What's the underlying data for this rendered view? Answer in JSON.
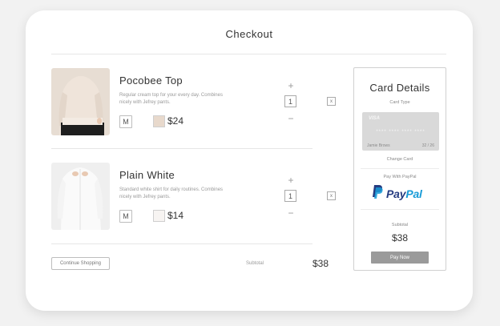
{
  "header": {
    "title": "Checkout"
  },
  "items": [
    {
      "name": "Pocobee Top",
      "description": "Regular cream top for your every day. Combines nicely with Jefrey pants.",
      "size": "M",
      "swatch_color": "#e8d9cc",
      "price": "$24",
      "qty_plus": "+",
      "quantity": "1",
      "qty_minus": "−",
      "remove": "x"
    },
    {
      "name": "Plain White",
      "description": "Standard white shirt for daily routines. Combines nicely with Jefrey pants.",
      "size": "M",
      "swatch_color": "#f7f4f2",
      "price": "$14",
      "qty_plus": "+",
      "quantity": "1",
      "qty_minus": "−",
      "remove": "x"
    }
  ],
  "footer": {
    "continue_label": "Continue Shopping",
    "subtotal_label": "Subtotal",
    "subtotal_value": "$38"
  },
  "payment": {
    "title": "Card Details",
    "card_type_label": "Card Type",
    "card": {
      "brand": "VISA",
      "number_mask": "****  ****  ****  ****",
      "holder": "Jamie Brows",
      "expiry": "32 / 26"
    },
    "change_card_label": "Change Card",
    "paypal_label": "Pay With PayPal",
    "paypal_brand_pay": "Pay",
    "paypal_brand_pal": "Pal",
    "subtotal_label": "Subtotal",
    "subtotal_value": "$38",
    "pay_button": "Pay Now"
  },
  "colors": {
    "paypal_dark": "#253b80",
    "paypal_light": "#179bd7",
    "pay_button": "#9a9a9a"
  }
}
